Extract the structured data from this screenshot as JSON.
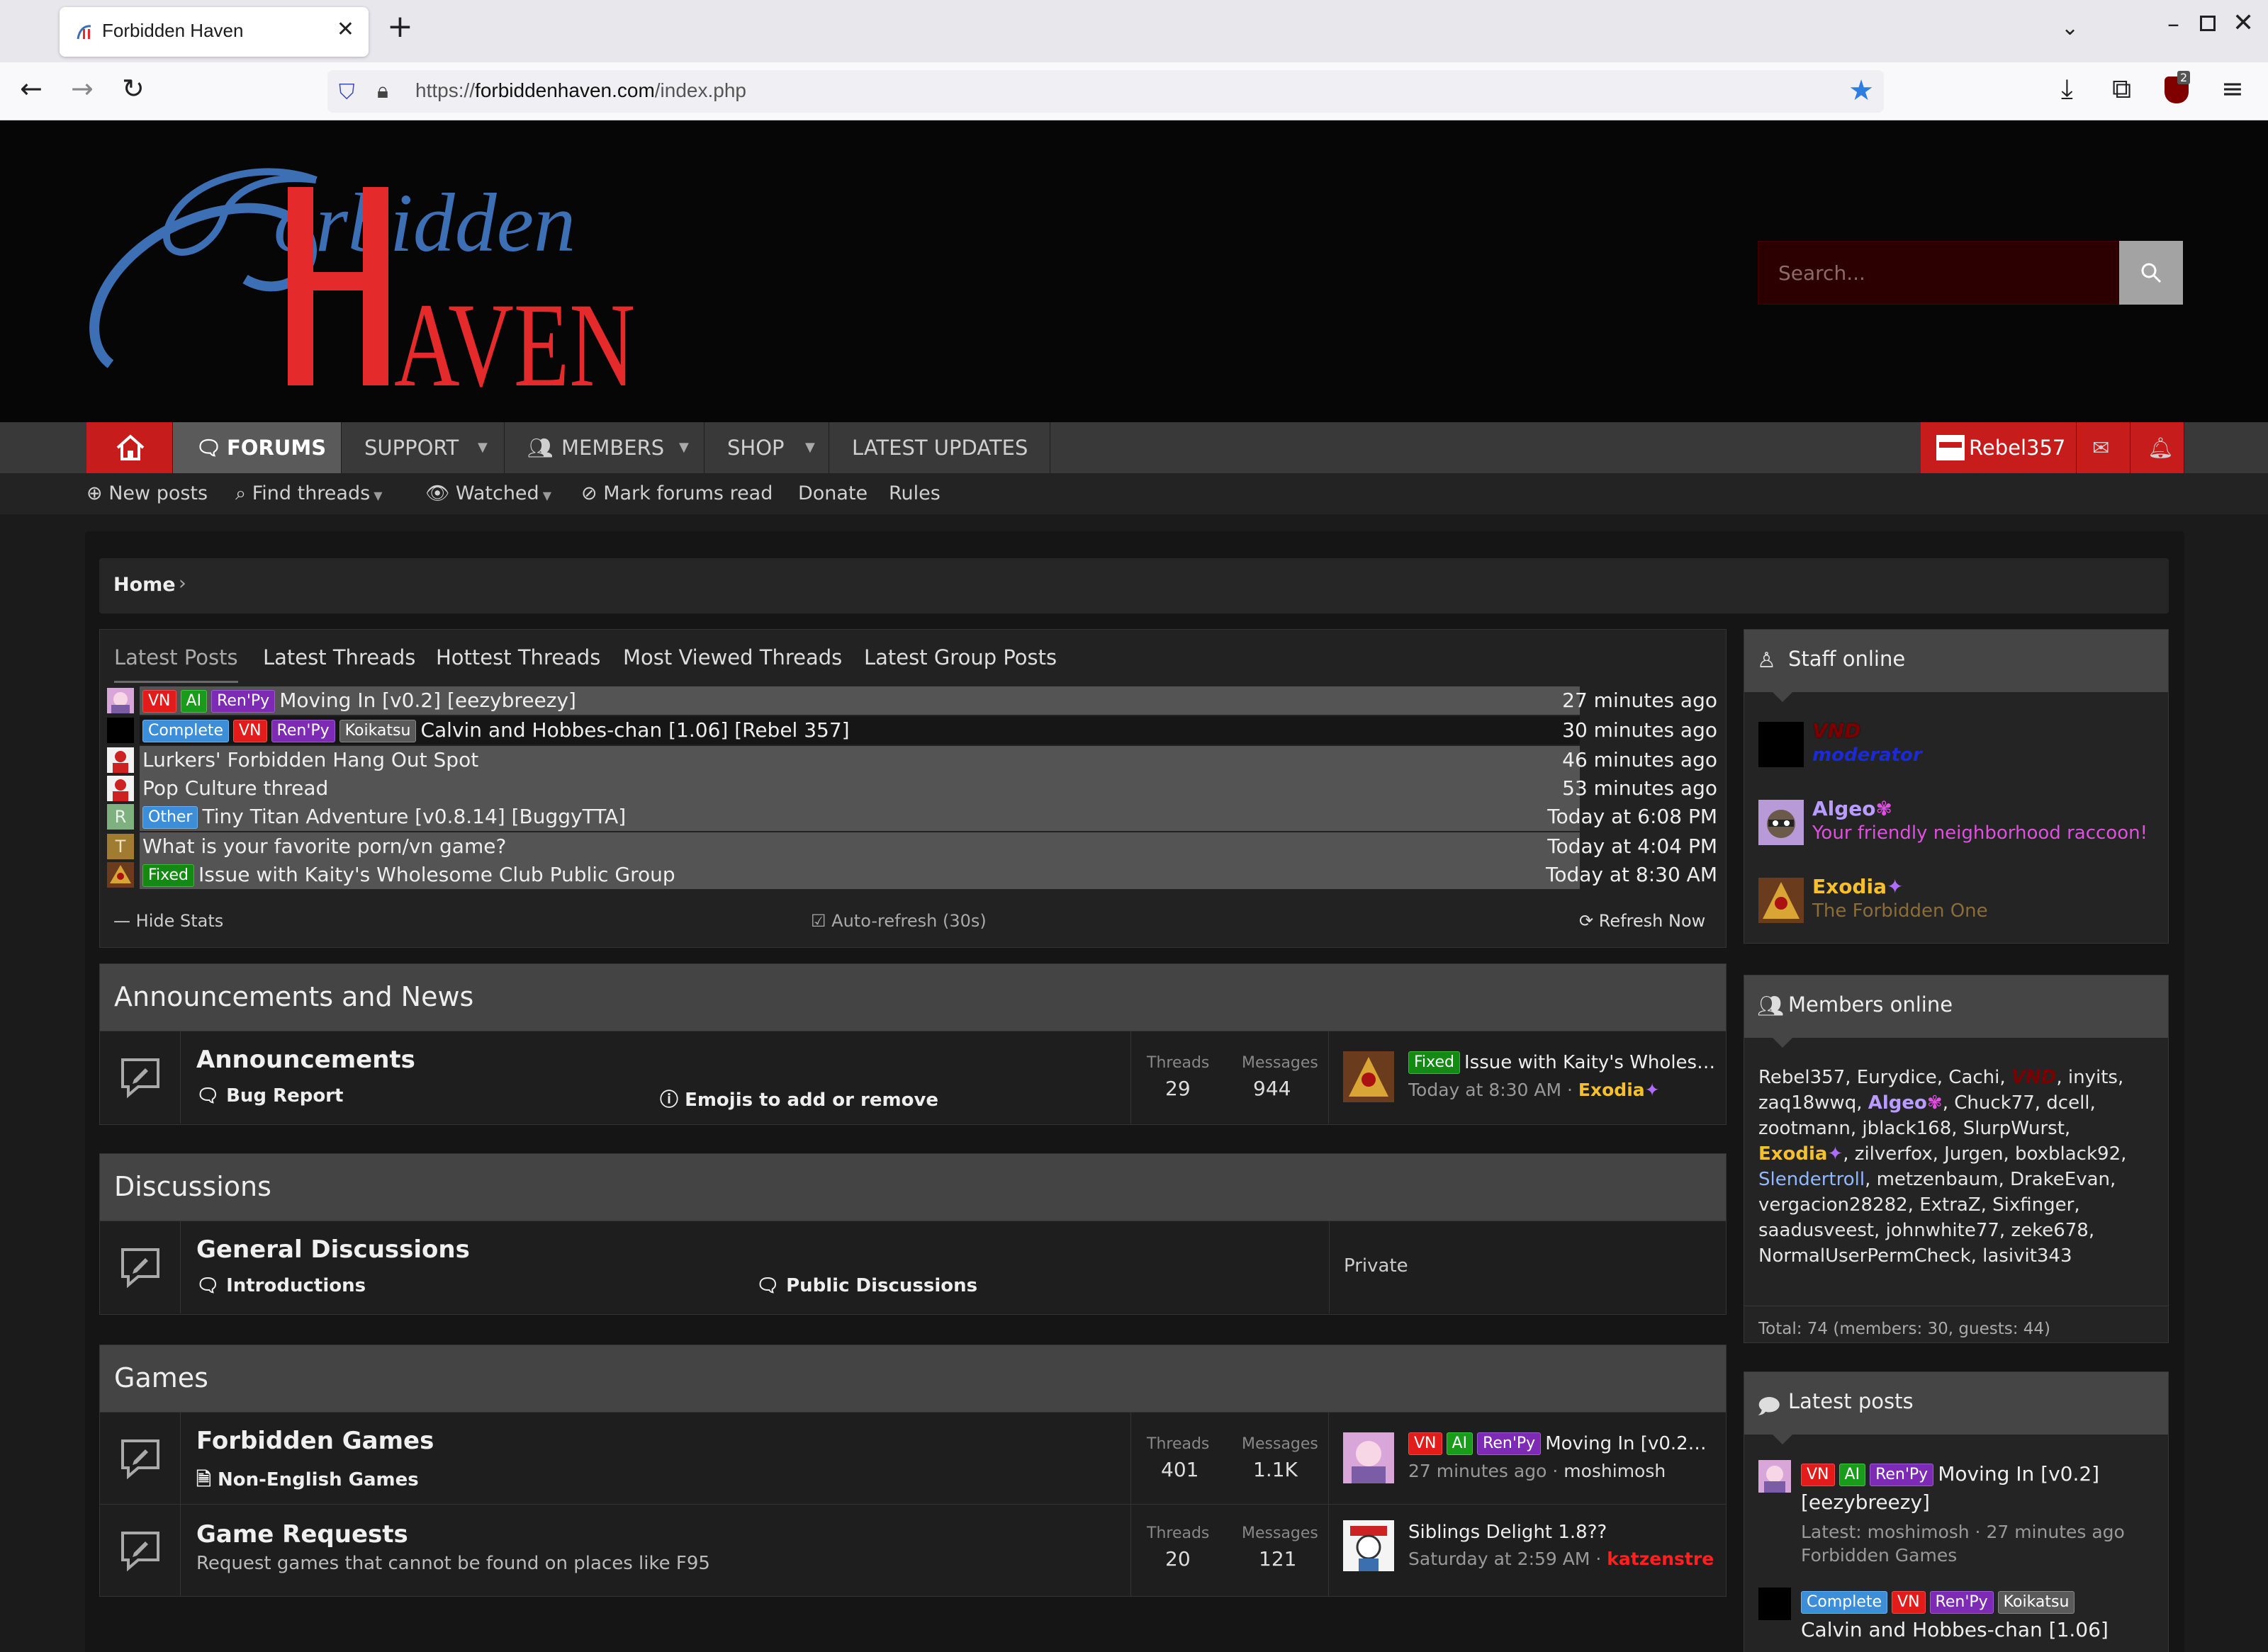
{
  "browser": {
    "tab_title": "Forbidden Haven",
    "url_prefix": "https://",
    "url_domain": "forbiddenhaven.com",
    "url_path": "/index.php",
    "ublock_count": "2"
  },
  "header": {
    "logo_text_top": "orbidden",
    "logo_text_bottom": "AVEN",
    "search_placeholder": "Search..."
  },
  "main_nav": {
    "forums": "FORUMS",
    "support": "SUPPORT",
    "members": "MEMBERS",
    "shop": "SHOP",
    "latest_updates": "LATEST UPDATES",
    "user": "Rebel357"
  },
  "sub_nav": {
    "new_posts": "New posts",
    "find_threads": "Find threads",
    "watched": "Watched",
    "mark_read": "Mark forums read",
    "donate": "Donate",
    "rules": "Rules"
  },
  "breadcrumb": {
    "home": "Home"
  },
  "stats": {
    "tabs": [
      "Latest Posts",
      "Latest Threads",
      "Hottest Threads",
      "Most Viewed Threads",
      "Latest Group Posts"
    ],
    "rows": [
      {
        "prefixes": [
          "VN",
          "AI",
          "Ren'Py"
        ],
        "title": "Moving In [v0.2] [eezybreezy]",
        "time": "27 minutes ago"
      },
      {
        "prefixes": [
          "Complete",
          "VN",
          "Ren'Py",
          "Koikatsu"
        ],
        "title": "Calvin and Hobbes-chan [1.06] [Rebel 357]",
        "time": "30 minutes ago"
      },
      {
        "prefixes": [],
        "title": "Lurkers' Forbidden Hang Out Spot",
        "time": "46 minutes ago"
      },
      {
        "prefixes": [],
        "title": "Pop Culture thread",
        "time": "53 minutes ago"
      },
      {
        "prefixes": [
          "Other"
        ],
        "title": "Tiny Titan Adventure [v0.8.14] [BuggyTTA]",
        "time": "Today at 6:08 PM",
        "avatar_letter": "R"
      },
      {
        "prefixes": [],
        "title": "What is your favorite porn/vn game?",
        "time": "Today at 4:04 PM",
        "avatar_letter": "T"
      },
      {
        "prefixes": [
          "Fixed"
        ],
        "title": "Issue with Kaity's Wholesome Club Public Group",
        "time": "Today at 8:30 AM"
      }
    ],
    "hide_stats": "Hide Stats",
    "auto_refresh": "Auto-refresh (30s)",
    "refresh_now": "Refresh Now"
  },
  "categories": {
    "announcements": {
      "title": "Announcements and News",
      "node_title": "Announcements",
      "sub1": "Bug Report",
      "sub2": "Emojis to add or remove",
      "threads_label": "Threads",
      "threads": "29",
      "messages_label": "Messages",
      "messages": "944",
      "last_prefix": "Fixed",
      "last_title": "Issue with Kaity's Wholes…",
      "last_time": "Today at 8:30 AM",
      "last_user": "Exodia"
    },
    "discussions": {
      "title": "Discussions",
      "node_title": "General Discussions",
      "sub1": "Introductions",
      "sub2": "Public Discussions",
      "last_text": "Private"
    },
    "games": {
      "title": "Games",
      "node1_title": "Forbidden Games",
      "node1_sub": "Non-English Games",
      "node1_threads": "401",
      "node1_messages": "1.1K",
      "node1_last_title": "Moving In [v0.2…",
      "node1_last_time": "27 minutes ago",
      "node1_last_user": "moshimosh",
      "node2_title": "Game Requests",
      "node2_desc": "Request games that cannot be found on places like F95",
      "node2_threads": "20",
      "node2_messages": "121",
      "node2_last_title": "Siblings Delight 1.8??",
      "node2_last_time": "Saturday at 2:59 AM",
      "node2_last_user": "katzenstre",
      "threads_label": "Threads",
      "messages_label": "Messages"
    }
  },
  "sidebar": {
    "staff_title": "Staff online",
    "staff": [
      {
        "name": "VND",
        "title": "moderator",
        "name_color": "#7a0000",
        "title_color": "#1a2bd6"
      },
      {
        "name": "Algeo",
        "title": "Your friendly neighborhood raccoon!",
        "name_color": "#b99cff",
        "title_color": "#e050e0"
      },
      {
        "name": "Exodia",
        "title": "The Forbidden One",
        "name_color": "#f5c030",
        "title_color": "#8a6d3a"
      }
    ],
    "members_title": "Members online",
    "members_before": "Rebel357, Eurydice, Cachi, ",
    "members_vnd": "VND",
    "members_mid1": ", inyits, zaq18wwq, ",
    "members_algeo": "Algeo",
    "members_mid2": ", Chuck77, dcell, zootmann, jblack168, SlurpWurst, ",
    "members_exodia": "Exodia",
    "members_mid3": ", zilverfox, Jurgen, boxblack92, ",
    "members_slender": "Slendertroll",
    "members_after": ", metzenbaum, DrakeEvan, vergacion28282, ExtraZ, Sixfinger, saadusveest, johnwhite77, zeke678, NormalUserPermCheck, lasivit343",
    "members_total": "Total: 74 (members: 30, guests: 44)",
    "latest_title": "Latest posts",
    "latest": [
      {
        "title": "Moving In [v0.2] [eezybreezy]",
        "meta": "Latest: moshimosh · 27 minutes ago",
        "forum": "Forbidden Games"
      },
      {
        "title": "Calvin and Hobbes-chan [1.06]"
      }
    ]
  },
  "colors": {
    "accent_red": "#c71c1c",
    "header_bg": "#060606",
    "logo_blue": "#3d6fb5",
    "logo_red": "#e42a2a"
  }
}
